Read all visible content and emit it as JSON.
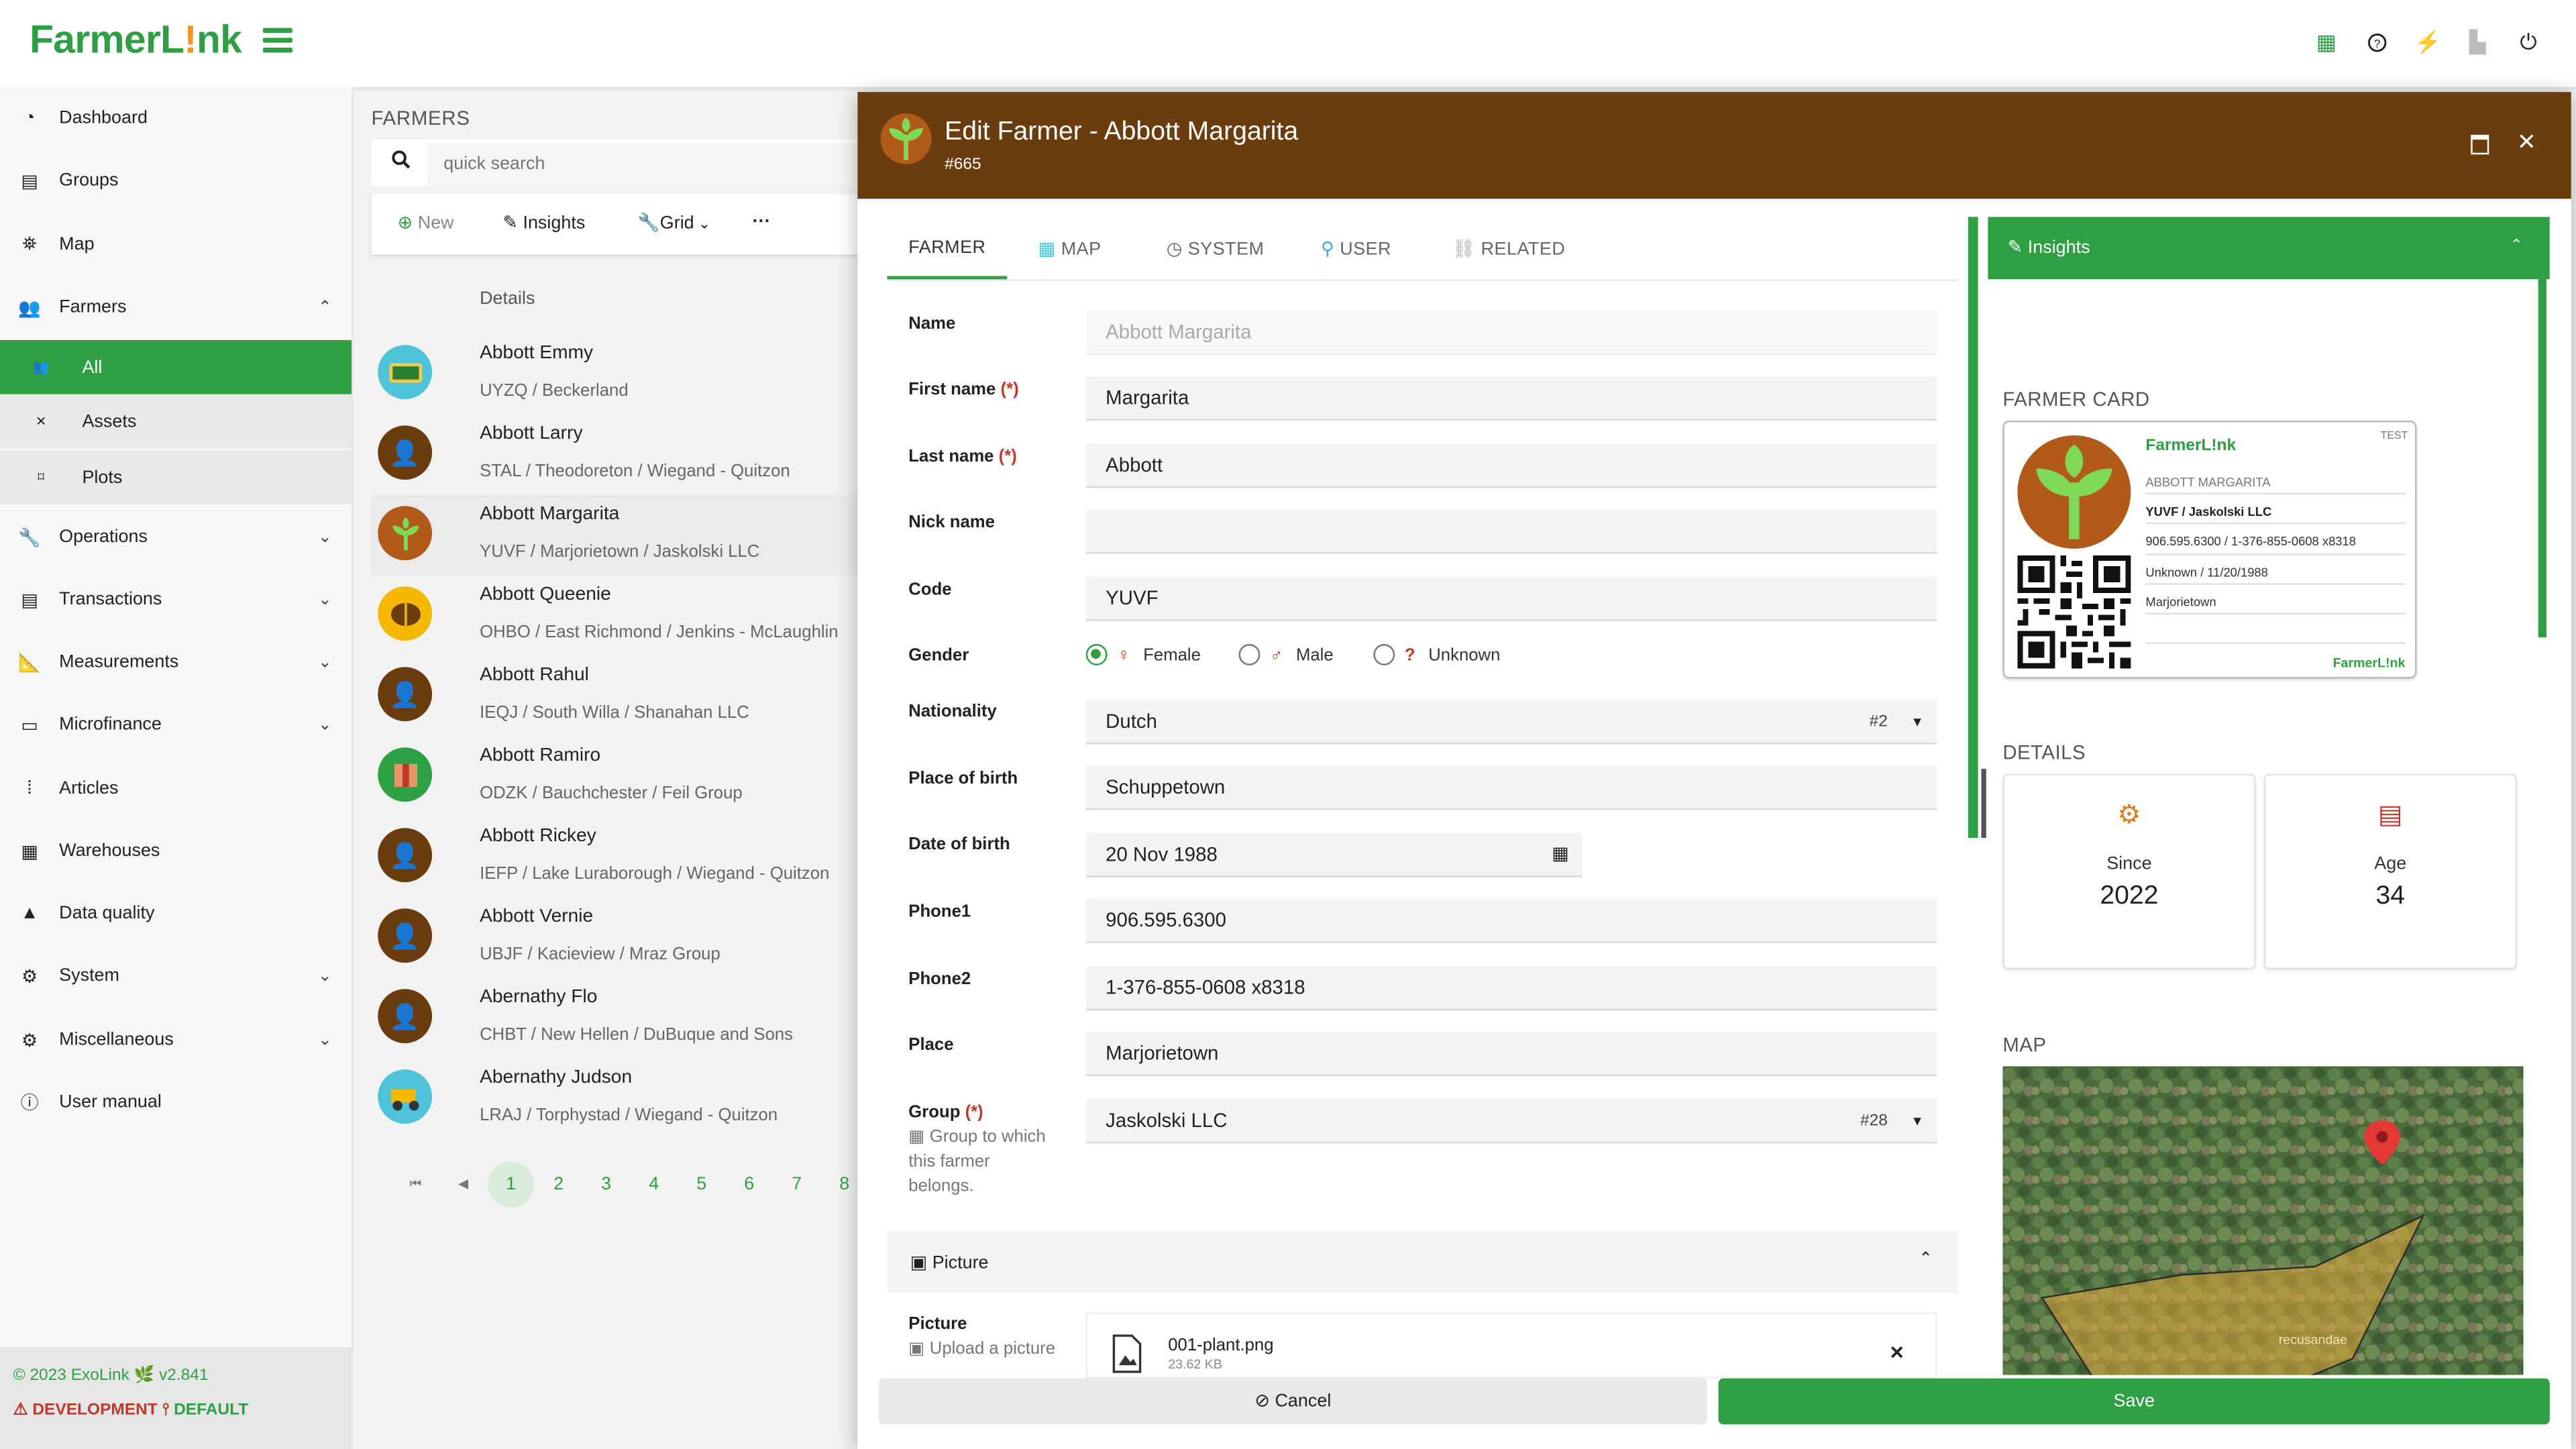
{
  "app": {
    "logo_main": "FarmerL",
    "logo_bang": "!",
    "logo_tail": "nk"
  },
  "sidebar": {
    "items": [
      {
        "label": "Dashboard"
      },
      {
        "label": "Groups"
      },
      {
        "label": "Map"
      },
      {
        "label": "Farmers"
      },
      {
        "label": "Operations"
      },
      {
        "label": "Transactions"
      },
      {
        "label": "Measurements"
      },
      {
        "label": "Microfinance"
      },
      {
        "label": "Articles"
      },
      {
        "label": "Warehouses"
      },
      {
        "label": "Data quality"
      },
      {
        "label": "System"
      },
      {
        "label": "Miscellaneous"
      },
      {
        "label": "User manual"
      }
    ],
    "farmers_sub": [
      {
        "label": "All"
      },
      {
        "label": "Assets"
      },
      {
        "label": "Plots"
      }
    ],
    "footer_copy": "© 2023 ExoLink 🌿 v2.841",
    "footer_env": "DEVELOPMENT",
    "footer_profile": "DEFAULT"
  },
  "list": {
    "title": "FARMERS",
    "search_placeholder": "quick search",
    "toolbar": {
      "new": "New",
      "insights": "Insights",
      "grid": "Grid",
      "more": "···"
    },
    "column_header": "Details",
    "rows": [
      {
        "name": "Abbott Emmy",
        "sub": "UYZQ / Beckerland"
      },
      {
        "name": "Abbott Larry",
        "sub": "STAL / Theodoreton / Wiegand - Quitzon"
      },
      {
        "name": "Abbott Margarita",
        "sub": "YUVF / Marjorietown / Jaskolski LLC"
      },
      {
        "name": "Abbott Queenie",
        "sub": "OHBO / East Richmond / Jenkins - McLaughlin"
      },
      {
        "name": "Abbott Rahul",
        "sub": "IEQJ / South Willa / Shanahan LLC"
      },
      {
        "name": "Abbott Ramiro",
        "sub": "ODZK / Bauchchester / Feil Group"
      },
      {
        "name": "Abbott Rickey",
        "sub": "IEFP / Lake Luraborough / Wiegand - Quitzon"
      },
      {
        "name": "Abbott Vernie",
        "sub": "UBJF / Kacieview / Mraz Group"
      },
      {
        "name": "Abernathy Flo",
        "sub": "CHBT / New Hellen / DuBuque and Sons"
      },
      {
        "name": "Abernathy Judson",
        "sub": "LRAJ / Torphystad / Wiegand - Quitzon"
      }
    ],
    "pages": [
      "1",
      "2",
      "3",
      "4",
      "5",
      "6",
      "7",
      "8"
    ]
  },
  "modal": {
    "title": "Edit Farmer - Abbott Margarita",
    "record_id": "#665",
    "tabs": [
      "FARMER",
      "MAP",
      "SYSTEM",
      "USER",
      "RELATED"
    ],
    "form": {
      "name_label": "Name",
      "name_value": "Abbott Margarita",
      "first_name_label": "First name",
      "first_name_value": "Margarita",
      "last_name_label": "Last name",
      "last_name_value": "Abbott",
      "nick_name_label": "Nick name",
      "nick_name_value": "",
      "code_label": "Code",
      "code_value": "YUVF",
      "gender_label": "Gender",
      "gender_options": [
        "Female",
        "Male",
        "Unknown"
      ],
      "gender_selected": "Female",
      "nationality_label": "Nationality",
      "nationality_value": "Dutch",
      "nationality_tag": "#2",
      "pob_label": "Place of birth",
      "pob_value": "Schuppetown",
      "dob_label": "Date of birth",
      "dob_value": "20 Nov 1988",
      "phone1_label": "Phone1",
      "phone1_value": "906.595.6300",
      "phone2_label": "Phone2",
      "phone2_value": "1-376-855-0608 x8318",
      "place_label": "Place",
      "place_value": "Marjorietown",
      "group_label": "Group",
      "group_help": "Group to which this farmer belongs.",
      "group_value": "Jaskolski LLC",
      "group_tag": "#28",
      "required_mark": "(*)"
    },
    "picture_section": "Picture",
    "picture_label": "Picture",
    "picture_help": "Upload a picture",
    "picture_file": "001-plant.png",
    "picture_size": "23.62 KB",
    "cancel": "Cancel",
    "save": "Save"
  },
  "insights": {
    "header": "Insights",
    "farmer_card_title": "FARMER CARD",
    "card": {
      "logo": "FarmerL!nk",
      "badge": "TEST",
      "name": "ABBOTT MARGARITA",
      "group": "YUVF / Jaskolski LLC",
      "phones": "906.595.6300 / 1-376-855-0608 x8318",
      "gender_dob": "Unknown / 11/20/1988",
      "place": "Marjorietown",
      "footer_logo": "FarmerL!nk"
    },
    "details_title": "DETAILS",
    "since_label": "Since",
    "since_value": "2022",
    "age_label": "Age",
    "age_value": "34",
    "map_title": "MAP",
    "plot_label": "recusandae"
  },
  "colors": {
    "brand_green": "#2ea043",
    "header_brown": "#6b3c0e",
    "accent_orange": "#e07a1f"
  }
}
